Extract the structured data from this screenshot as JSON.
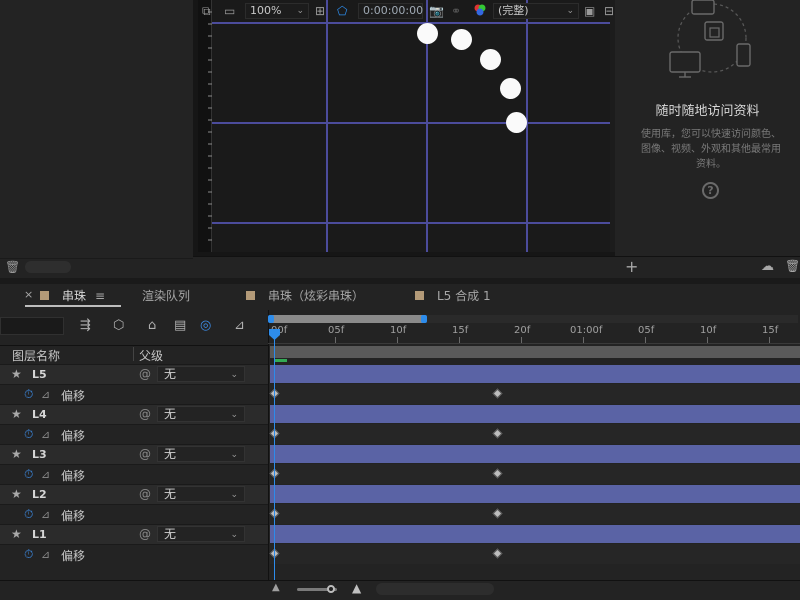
{
  "viewer": {
    "zoom": "100%",
    "timecode": "0:00:00:00",
    "resolution": "(完整)"
  },
  "library": {
    "title": "随时随地访问资料",
    "description": "使用库，您可以快速访问颜色、图像、视频、外观和其他最常用资料。",
    "help": "?"
  },
  "tabs": [
    {
      "label": "串珠",
      "active": true
    },
    {
      "label": "渲染队列",
      "active": false
    },
    {
      "label": "串珠（炫彩串珠）",
      "active": false
    },
    {
      "label": "L5 合成 1",
      "active": false
    }
  ],
  "columns": {
    "layer_name": "图层名称",
    "parent": "父级"
  },
  "layers": [
    {
      "name": "L5",
      "parent": "无",
      "property": "偏移"
    },
    {
      "name": "L4",
      "parent": "无",
      "property": "偏移"
    },
    {
      "name": "L3",
      "parent": "无",
      "property": "偏移"
    },
    {
      "name": "L2",
      "parent": "无",
      "property": "偏移"
    },
    {
      "name": "L1",
      "parent": "无",
      "property": "偏移"
    }
  ],
  "timeline_ruler": [
    "00f",
    "05f",
    "10f",
    "15f",
    "20f",
    "01:00f",
    "05f",
    "10f",
    "15f"
  ],
  "colors": {
    "playhead": "#2d8ceb",
    "layer_bar": "#5a63a5",
    "grid": "#4c4c9c",
    "label_swatch": "#b39a78"
  }
}
